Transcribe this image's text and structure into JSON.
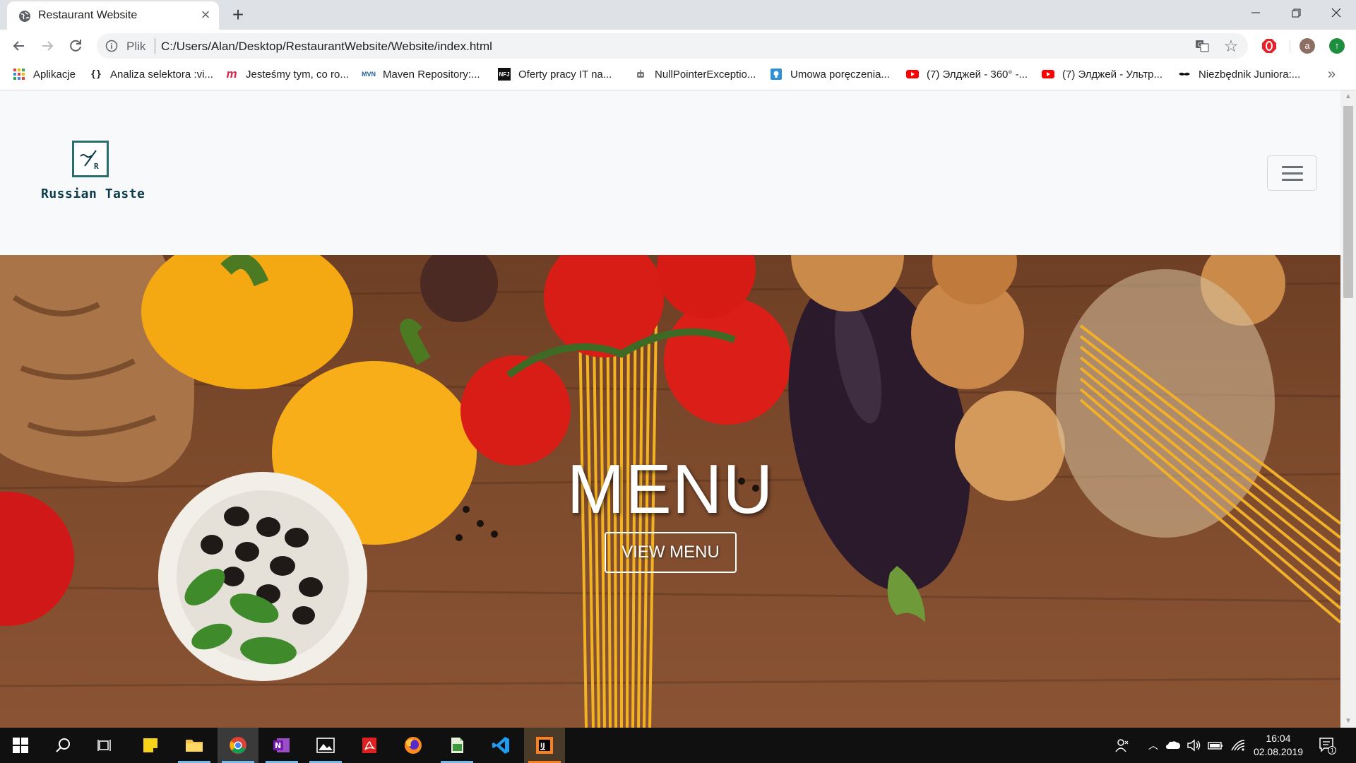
{
  "browser": {
    "tab": {
      "title": "Restaurant Website"
    },
    "address": {
      "scheme_label": "Plik",
      "url": "C:/Users/Alan/Desktop/RestaurantWebsite/Website/index.html"
    },
    "avatar_letter": "a",
    "bookmarks": [
      {
        "label": "Aplikacje",
        "icon": "apps-grid-icon"
      },
      {
        "label": "Analiza selektora :vi...",
        "icon": "braces-icon"
      },
      {
        "label": "Jesteśmy tym, co ro...",
        "icon": "m-logo-icon"
      },
      {
        "label": "Maven Repository:...",
        "icon": "mvn-icon"
      },
      {
        "label": "Oferty pracy IT na...",
        "icon": "nfj-icon"
      },
      {
        "label": "NullPointerExceptio...",
        "icon": "robot-icon"
      },
      {
        "label": "Umowa poręczenia...",
        "icon": "lightbulb-icon"
      },
      {
        "label": "(7) Элджей - 360° -...",
        "icon": "youtube-icon"
      },
      {
        "label": "(7) Элджей - Ультр...",
        "icon": "youtube-icon"
      },
      {
        "label": "Niezbędnik Juniora:...",
        "icon": "mustache-icon"
      }
    ],
    "bookmarks_more": "»"
  },
  "site": {
    "brand": "Russian Taste",
    "hero": {
      "title": "MENU",
      "button_label": "VIEW MENU"
    }
  },
  "taskbar": {
    "time": "16:04",
    "date": "02.08.2019",
    "notifications": "1"
  }
}
